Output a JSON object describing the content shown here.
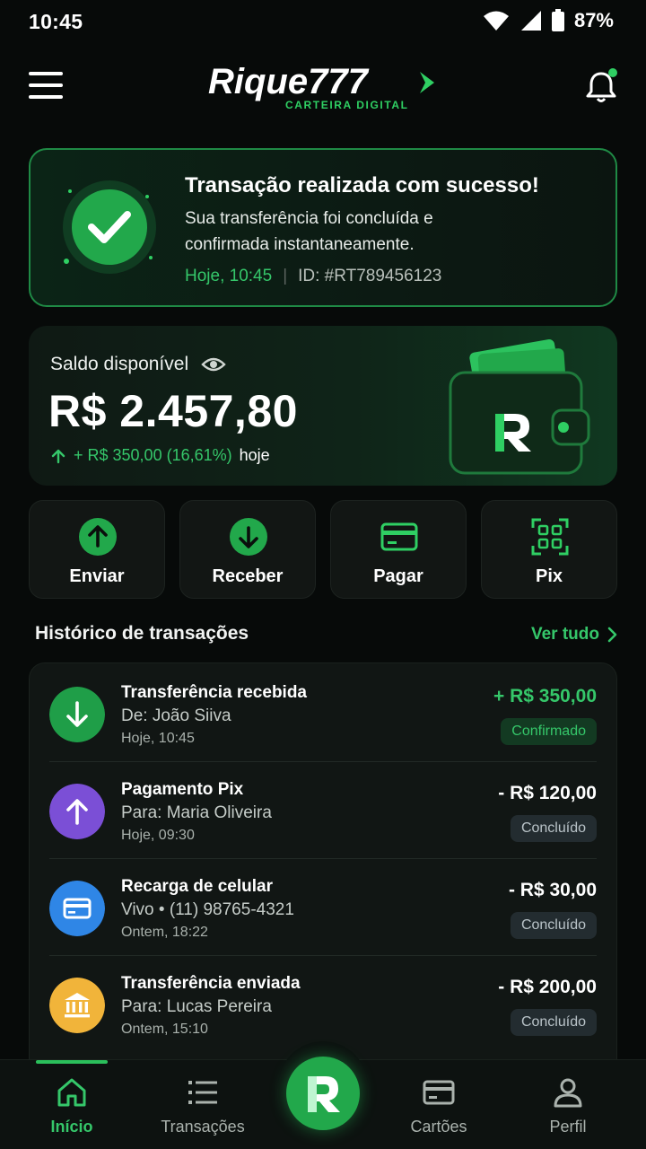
{
  "status_bar": {
    "time": "10:45",
    "battery": "87%"
  },
  "header": {
    "logo_text": "Rique777",
    "logo_tagline": "CARTEIRA DIGITAL"
  },
  "success": {
    "title": "Transação realizada com sucesso!",
    "description": "Sua transferência foi concluída e confirmada instantaneamente.",
    "time": "Hoje, 10:45",
    "separator": "|",
    "id": "ID: #RT789456123"
  },
  "balance": {
    "label": "Saldo disponível",
    "amount": "R$ 2.457,80",
    "change": "+ R$ 350,00 (16,61%)",
    "change_suffix": "hoje"
  },
  "actions": [
    {
      "label": "Enviar",
      "icon": "arrow-up-circle-icon"
    },
    {
      "label": "Receber",
      "icon": "arrow-down-circle-icon"
    },
    {
      "label": "Pagar",
      "icon": "card-icon"
    },
    {
      "label": "Pix",
      "icon": "qr-code-icon"
    }
  ],
  "history": {
    "title": "Histórico de transações",
    "see_all": "Ver tudo",
    "items": [
      {
        "title": "Transferência recebida",
        "subtitle": "De: João Siiva",
        "time": "Hoje, 10:45",
        "amount": "+ R$ 350,00",
        "status": "Confirmado",
        "icon": "arrow-down-icon",
        "color": "#1f9e48"
      },
      {
        "title": "Pagamento Pix",
        "subtitle": "Para: Maria Oliveira",
        "time": "Hoje, 09:30",
        "amount": "- R$ 120,00",
        "status": "Concluído",
        "icon": "arrow-up-icon",
        "color": "#7b4fd6"
      },
      {
        "title": "Recarga de celular",
        "subtitle": "Vivo • (11) 98765-4321",
        "time": "Ontem, 18:22",
        "amount": "- R$ 30,00",
        "status": "Concluído",
        "icon": "card-icon",
        "color": "#2f86e6"
      },
      {
        "title": "Transferência enviada",
        "subtitle": "Para: Lucas Pereira",
        "time": "Ontem, 15:10",
        "amount": "- R$ 200,00",
        "status": "Concluído",
        "icon": "bank-icon",
        "color": "#f1b43a"
      }
    ]
  },
  "nav": {
    "items": [
      {
        "label": "Início",
        "icon": "home-icon",
        "active": true
      },
      {
        "label": "Transações",
        "icon": "list-icon",
        "active": false
      },
      {
        "label": "Cartões",
        "icon": "card-icon",
        "active": false
      },
      {
        "label": "Perfil",
        "icon": "user-icon",
        "active": false
      }
    ]
  },
  "colors": {
    "accent": "#35c76a",
    "background": "#070a09"
  }
}
